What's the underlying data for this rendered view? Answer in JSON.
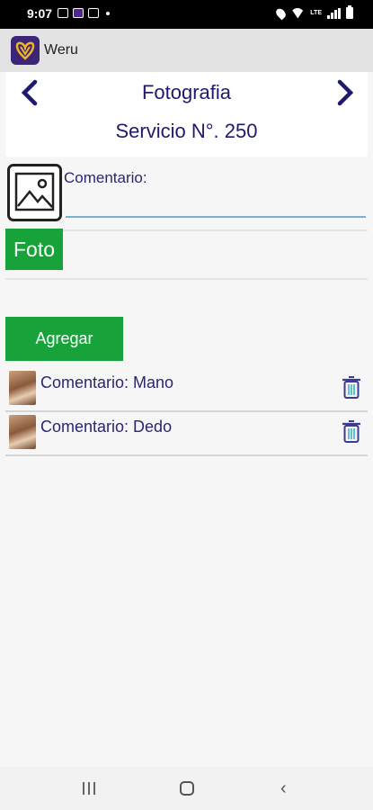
{
  "status_bar": {
    "time": "9:07",
    "network": "LTE"
  },
  "app": {
    "title": "Weru",
    "brand_color": "#3b2577"
  },
  "header": {
    "title": "Fotografia",
    "service": "Servicio N°. 250",
    "prev_icon": "chevron-left-icon",
    "next_icon": "chevron-right-icon"
  },
  "form": {
    "comment_label": "Comentario:",
    "comment_value": "",
    "foto_button": "Foto",
    "add_button": "Agregar",
    "button_color": "#18a33a"
  },
  "photos": [
    {
      "comment": "Comentario: Mano"
    },
    {
      "comment": "Comentario: Dedo"
    }
  ],
  "colors": {
    "text": "#1e1a6d",
    "accent_underline": "#7aaed3"
  }
}
